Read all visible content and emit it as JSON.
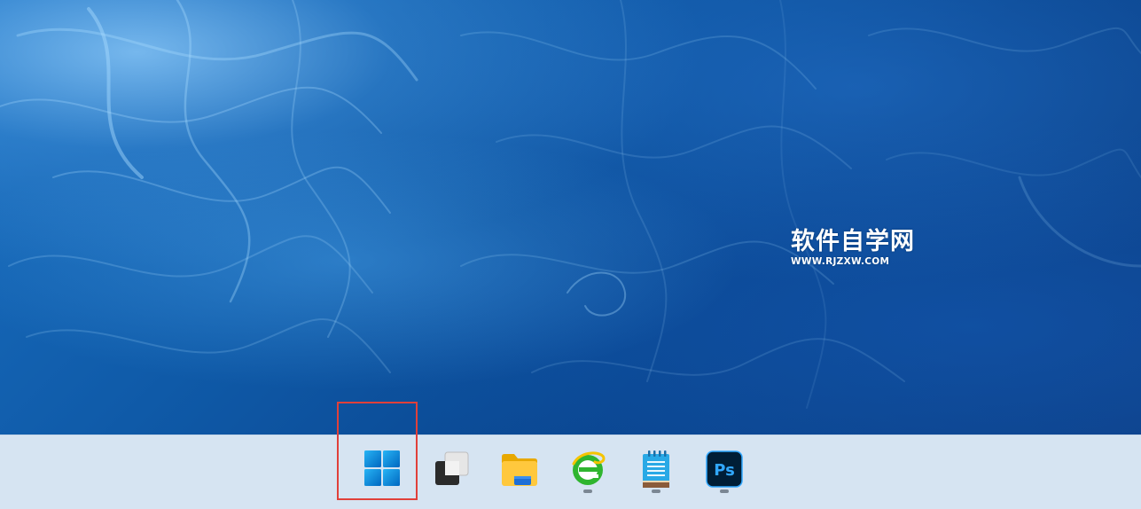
{
  "desktop": {
    "wallpaper": "blue-smoke",
    "colors": {
      "base": "#0f5aa8",
      "highlight": "#9fd3ff"
    }
  },
  "watermark": {
    "title": "软件自学网",
    "url": "WWW.RJZXW.COM"
  },
  "taskbar": {
    "background": "#d6e4f2",
    "items": [
      {
        "icon": "windows-start-icon",
        "running": false
      },
      {
        "icon": "task-view-icon",
        "running": false
      },
      {
        "icon": "file-explorer-icon",
        "running": false
      },
      {
        "icon": "browser-e-icon",
        "running": true
      },
      {
        "icon": "notepad-icon",
        "running": true
      },
      {
        "icon": "photoshop-icon",
        "label": "Ps",
        "running": true
      }
    ]
  },
  "annotation": {
    "highlight_color": "#e0403a",
    "target": "windows-start-icon"
  }
}
